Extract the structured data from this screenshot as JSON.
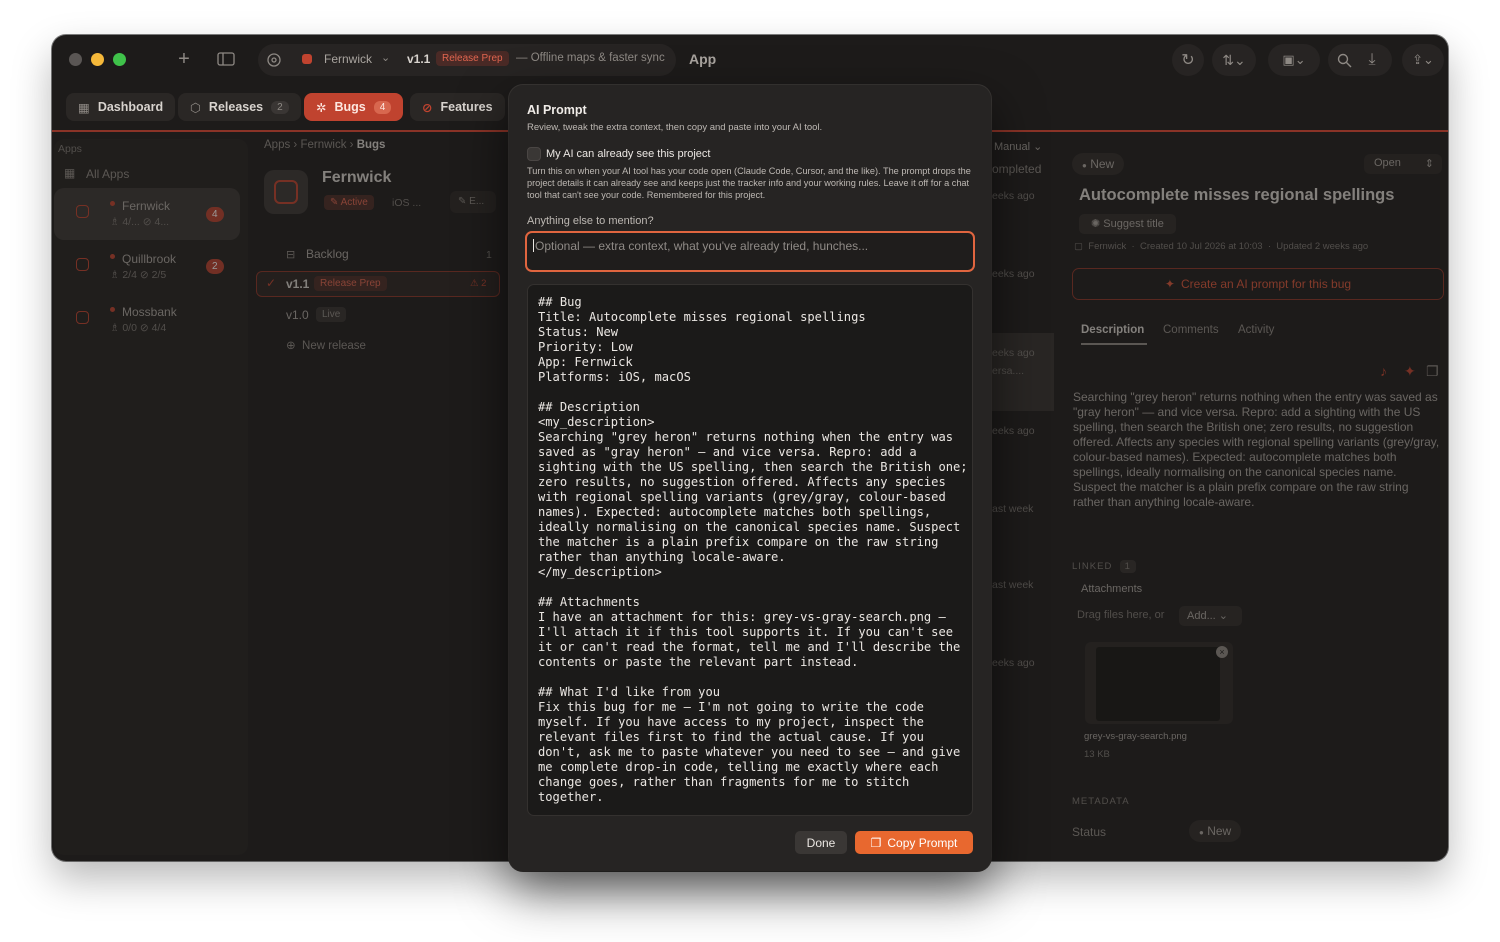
{
  "titlebar": {
    "project": "Fernwick",
    "version": "v1.1",
    "version_chip": "Release Prep",
    "version_note": "— Offline maps & faster sync",
    "app_label": "App"
  },
  "tabs": [
    {
      "label": "Dashboard",
      "count": ""
    },
    {
      "label": "Releases",
      "count": "2"
    },
    {
      "label": "Bugs",
      "count": "4"
    },
    {
      "label": "Features",
      "count": ""
    }
  ],
  "sidebar": {
    "header": "Apps",
    "all_apps": "All Apps",
    "apps": [
      {
        "name": "Fernwick",
        "stats_a": "4/...",
        "stats_b": "4...",
        "badge": "4"
      },
      {
        "name": "Quillbrook",
        "stats_a": "2/4",
        "stats_b": "2/5",
        "badge": "2"
      },
      {
        "name": "Mossbank",
        "stats_a": "0/0",
        "stats_b": "4/4",
        "badge": ""
      }
    ]
  },
  "middle": {
    "breadcrumb": [
      "Apps",
      "Fernwick",
      "Bugs"
    ],
    "project_title": "Fernwick",
    "project_status": "Active",
    "project_platform": "iOS ...",
    "project_edit": "E...",
    "backlog_label": "Backlog",
    "backlog_count": "1",
    "releases": [
      {
        "version": "v1.1",
        "chip": "Release Prep",
        "warn": "2"
      },
      {
        "version": "v1.0",
        "chip": "Live",
        "warn": ""
      }
    ],
    "new_release": "New release"
  },
  "list_peek": {
    "sort": "Manual",
    "completed": "ompleted",
    "rows": [
      "eeks ago",
      "eeks ago",
      "eeks ago",
      "ersa....",
      "eeks ago",
      "ast week",
      "ast week",
      "eeks ago"
    ]
  },
  "dialog": {
    "title": "AI Prompt",
    "subtitle": "Review, tweak the extra context, then copy and paste into your AI tool.",
    "checkbox_label": "My AI can already see this project",
    "help": "Turn this on when your AI tool has your code open (Claude Code, Cursor, and the like). The prompt drops the project details it can already see and keeps just the tracker info and your working rules. Leave it off for a chat tool that can't see your code. Remembered for this project.",
    "field_label": "Anything else to mention?",
    "field_placeholder": "Optional — extra context, what you've already tried, hunches...",
    "prompt": "## Bug\nTitle: Autocomplete misses regional spellings\nStatus: New\nPriority: Low\nApp: Fernwick\nPlatforms: iOS, macOS\n\n## Description\n<my_description>\nSearching \"grey heron\" returns nothing when the entry was saved as \"gray heron\" — and vice versa. Repro: add a sighting with the US spelling, then search the British one; zero results, no suggestion offered. Affects any species with regional spelling variants (grey/gray, colour-based names). Expected: autocomplete matches both spellings, ideally normalising on the canonical species name. Suspect the matcher is a plain prefix compare on the raw string rather than anything locale-aware.\n</my_description>\n\n## Attachments\nI have an attachment for this: grey-vs-gray-search.png — I'll attach it if this tool supports it. If you can't see it or can't read the format, tell me and I'll describe the contents or paste the relevant part instead.\n\n## What I'd like from you\nFix this bug for me — I'm not going to write the code myself. If you have access to my project, inspect the relevant files first to find the actual cause. If you don't, ask me to paste whatever you need to see — and give me complete drop-in code, telling me exactly where each change goes, rather than fragments for me to stitch together.",
    "done_label": "Done",
    "copy_label": "Copy Prompt"
  },
  "detail": {
    "status_chip": "New",
    "state_select": "Open",
    "title": "Autocomplete misses regional spellings",
    "suggest_title": "Suggest title",
    "meta_project": "Fernwick",
    "meta_created": "Created 10 Jul 2026 at 10:03",
    "meta_updated": "Updated 2 weeks ago",
    "ai_button": "Create an AI prompt for this bug",
    "tabs": [
      "Description",
      "Comments",
      "Activity"
    ],
    "description": "Searching \"grey heron\" returns nothing when the entry was saved as \"gray heron\" — and vice versa. Repro: add a sighting with the US spelling, then search the British one; zero results, no suggestion offered. Affects any species with regional spelling variants (grey/gray, colour-based names). Expected: autocomplete matches both spellings, ideally normalising on the canonical species name. Suspect the matcher is a plain prefix compare on the raw string rather than anything locale-aware.",
    "linked_label": "LINKED",
    "linked_count": "1",
    "attachments_label": "Attachments",
    "drag_text": "Drag files here, or",
    "add_label": "Add...",
    "attachment_name": "grey-vs-gray-search.png",
    "attachment_size": "13 KB",
    "metadata_label": "METADATA",
    "status_label": "Status",
    "status_value": "New"
  },
  "colors": {
    "accent": "#e8682f",
    "danger": "#c0432f",
    "window_bg": "#1d1b1a",
    "dialog_bg": "#262423"
  }
}
